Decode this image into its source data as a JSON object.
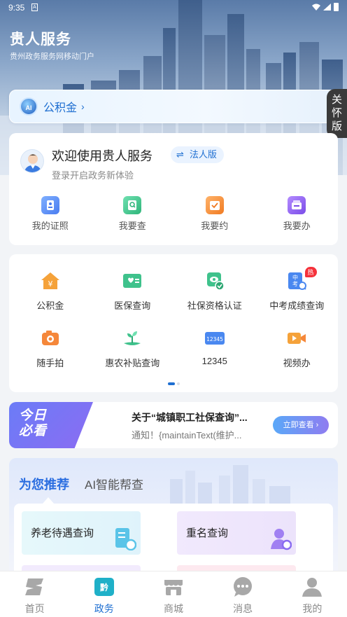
{
  "status_bar": {
    "time": "9:35",
    "sim_icon": "A"
  },
  "brand": {
    "title": "贵人服务",
    "subtitle": "贵州政务服务网移动门户"
  },
  "gjj_bar": {
    "ai_badge": "AI",
    "label": "公积金",
    "chevron": "›"
  },
  "care_mode": {
    "label_lines": [
      "关",
      "怀",
      "版"
    ]
  },
  "welcome": {
    "title": "欢迎使用贵人服务",
    "corp_switch_icon": "⇌",
    "corp_label": "法人版",
    "subtitle": "登录开启政务新体验"
  },
  "quick_actions": [
    {
      "label": "我的证照",
      "icon": "id-card-icon",
      "color": "#5a8cf5"
    },
    {
      "label": "我要查",
      "icon": "search-doc-icon",
      "color": "#3fc28c"
    },
    {
      "label": "我要约",
      "icon": "calendar-check-icon",
      "color": "#f58a2f"
    },
    {
      "label": "我要办",
      "icon": "folder-icon",
      "color": "#8a5cf0"
    }
  ],
  "services": [
    {
      "label": "公积金",
      "icon": "house-yuan-icon",
      "color": "#f5a23a"
    },
    {
      "label": "医保查询",
      "icon": "medical-card-icon",
      "color": "#3fc28c"
    },
    {
      "label": "社保资格认证",
      "icon": "social-auth-icon",
      "color": "#3fc28c"
    },
    {
      "label": "中考成绩查询",
      "icon": "exam-search-icon",
      "color": "#4a88f0",
      "badge": "热"
    },
    {
      "label": "随手拍",
      "icon": "camera-icon",
      "color": "#f5873a"
    },
    {
      "label": "惠农补贴查询",
      "icon": "sprout-icon",
      "color": "#3fc28c"
    },
    {
      "label": "12345",
      "icon": "hotline-12345-icon",
      "color": "#4a88f0",
      "icon_text": "12345"
    },
    {
      "label": "视频办",
      "icon": "video-camera-icon",
      "color": "#f5a23a"
    }
  ],
  "today_notice": {
    "tag_line1": "今日",
    "tag_line2": "必看",
    "title": "关于“城镇职工社保查询”...",
    "body": "通知！{maintainText(维护...",
    "button": "立即查看 ›"
  },
  "recommend": {
    "tabs": [
      "为您推荐",
      "AI智能帮查"
    ],
    "items": [
      {
        "label": "养老待遇查询",
        "icon": "pension-search-icon",
        "color": "#4ab0e0"
      },
      {
        "label": "重名查询",
        "icon": "person-search-icon",
        "color": "#8a6cf0"
      }
    ]
  },
  "tabbar": [
    {
      "label": "首页",
      "icon": "home-logo-icon",
      "active": false
    },
    {
      "label": "政务",
      "icon": "gov-affairs-icon",
      "active": true
    },
    {
      "label": "商城",
      "icon": "store-icon",
      "active": false
    },
    {
      "label": "消息",
      "icon": "message-icon",
      "active": false
    },
    {
      "label": "我的",
      "icon": "profile-icon",
      "active": false
    }
  ],
  "colors": {
    "primary": "#1f6fd1",
    "hot": "#f5313a"
  }
}
